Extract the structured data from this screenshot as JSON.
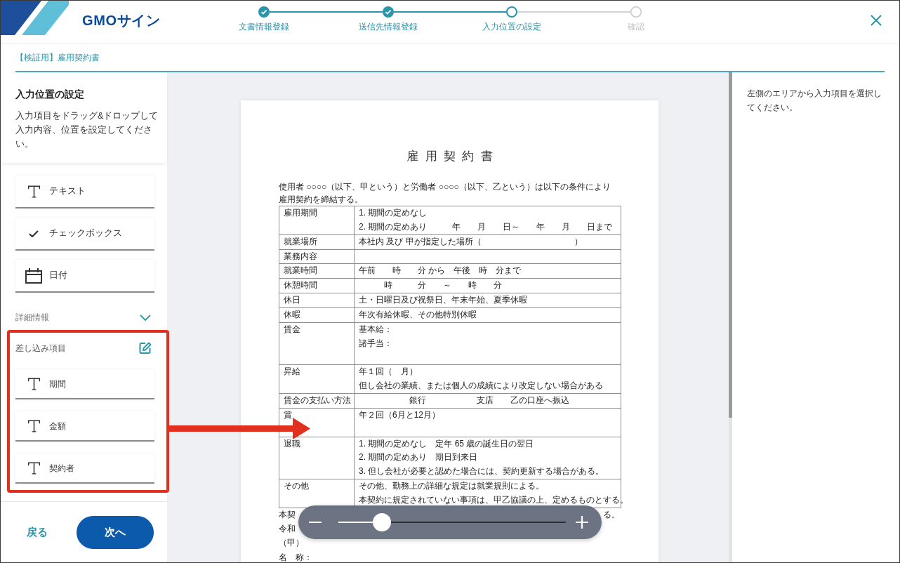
{
  "header": {
    "logo_text": "GMOサイン",
    "steps": [
      {
        "label": "文書情報登録",
        "completed": true,
        "selected": false
      },
      {
        "label": "送信先情報登録",
        "completed": true,
        "selected": false
      },
      {
        "label": "入力位置の設定",
        "completed": false,
        "selected": true
      },
      {
        "label": "確認",
        "completed": false,
        "selected": false
      }
    ]
  },
  "document_title": "【検証用】雇用契約書",
  "left_panel": {
    "title": "入力位置の設定",
    "description": "入力項目をドラッグ&ドロップして入力内容、位置を設定してください。",
    "field_items": [
      {
        "label": "テキスト",
        "kind": "text"
      },
      {
        "label": "チェックボックス",
        "kind": "checkbox"
      },
      {
        "label": "日付",
        "kind": "date"
      }
    ],
    "details": {
      "label": "詳細情報",
      "expanded": false
    },
    "merge_fields": {
      "label": "差し込み項目",
      "highlighted": true,
      "items": [
        {
          "label": "期間",
          "kind": "text"
        },
        {
          "label": "金額",
          "kind": "text"
        },
        {
          "label": "契約者",
          "kind": "text"
        }
      ]
    },
    "back_button": "戻る",
    "next_button": "次へ"
  },
  "document": {
    "title": "雇用契約書",
    "intro": "使用者 ○○○○（以下、甲という）と労働者 ○○○○（以下、乙という）は以下の条件により雇用契約を締結する。",
    "table": {
      "rows": [
        {
          "label": "雇用期間",
          "lines": [
            "1. 期間の定めなし",
            "2. 期間の定めあり　　　年　　月　　日～　　年　　月　　日まで"
          ]
        },
        {
          "label": "就業場所",
          "lines": [
            "本社内 及び 甲が指定した場所（　　　　　　　　　　　）"
          ]
        },
        {
          "label": "業務内容"
        },
        {
          "label": "就業時間",
          "lines": [
            "午前　　時　　分 から　午後　時　分まで"
          ]
        },
        {
          "label": "休憩時間",
          "lines": [
            "　　　時　　　分　　～　　時　　分"
          ]
        },
        {
          "label": "休日",
          "lines": [
            "土・日曜日及び祝祭日、年末年始、夏季休暇"
          ]
        },
        {
          "label": "休暇",
          "lines": [
            "年次有給休暇、その他特別休暇"
          ]
        },
        {
          "label": "賃金",
          "lines": [
            "基本給：",
            "諸手当："
          ]
        },
        {
          "label": "昇給",
          "lines": [
            "年１回（　月）",
            "但し会社の業績、または個人の成績により改定しない場合がある"
          ]
        },
        {
          "label": "賃金の支払い方法",
          "lines": [
            "　　　　　　銀行　　　　　　支店　　乙の口座へ振込"
          ]
        },
        {
          "label": "賞",
          "lines": [
            "年２回（6月と12月）"
          ]
        },
        {
          "label": "退職",
          "lines": [
            "1. 期間の定めなし　定年 65 歳の誕生日の翌日",
            "2. 期間の定めあり　期日到来日",
            "3. 但し会社が必要と認めた場合には、契約更新する場合がある。"
          ]
        },
        {
          "label": "その他",
          "lines": [
            "その他、勤務上の詳細な規定は就業規則による。",
            "本契約に規定されていない事項は、甲乙協議の上、定めるものとする。"
          ]
        }
      ]
    },
    "closing_lines": [
      {
        "parts": [
          "本契",
          "る。"
        ]
      },
      {
        "parts": [
          "令和"
        ]
      },
      {
        "parts": [
          "（甲）"
        ]
      },
      {
        "parts": [
          "名　称："
        ]
      }
    ]
  },
  "zoom_control": {
    "level": 0.19
  },
  "right_panel": {
    "message": "左側のエリアから入力項目を選択してください。"
  }
}
